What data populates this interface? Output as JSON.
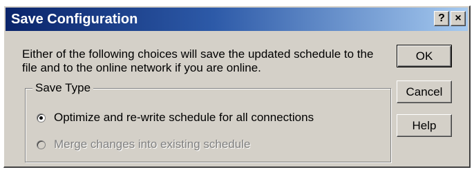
{
  "window": {
    "title": "Save Configuration",
    "help_button": "?",
    "close_button": "×"
  },
  "description": "Either of the following choices will save the updated schedule to the file and to the online network if you are online.",
  "save_type": {
    "legend": "Save Type",
    "options": [
      {
        "label": "Optimize and re-write schedule for all connections",
        "selected": true,
        "enabled": true
      },
      {
        "label": "Merge changes into existing schedule",
        "selected": false,
        "enabled": false
      }
    ]
  },
  "buttons": {
    "ok": "OK",
    "cancel": "Cancel",
    "help": "Help"
  },
  "colors": {
    "title_gradient_start": "#0a246a",
    "title_gradient_end": "#a6caf0",
    "face": "#d4d0c8"
  }
}
